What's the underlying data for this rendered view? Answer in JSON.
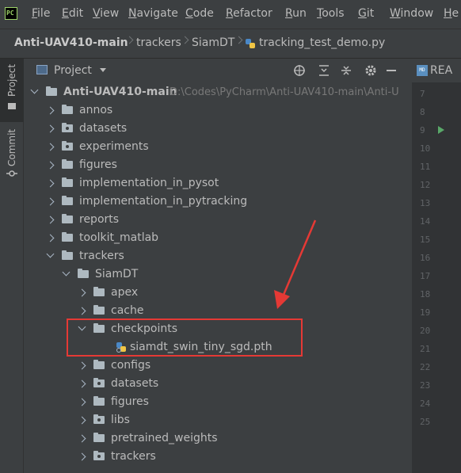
{
  "menu": {
    "logo_text": "PC",
    "items": [
      {
        "mn": "F",
        "rest": "ile"
      },
      {
        "mn": "E",
        "rest": "dit"
      },
      {
        "mn": "V",
        "rest": "iew"
      },
      {
        "mn": "N",
        "rest": "avigate"
      },
      {
        "mn": "C",
        "rest": "ode"
      },
      {
        "mn": "R",
        "rest": "efactor"
      },
      {
        "mn": "R",
        "rest": "un",
        "pre": ""
      },
      {
        "mn": "T",
        "rest": "ools"
      },
      {
        "mn": "G",
        "rest": "it"
      },
      {
        "mn": "W",
        "rest": "indow"
      },
      {
        "mn": "H",
        "rest": "e"
      }
    ]
  },
  "breadcrumb": {
    "project": "Anti-UAV410-main",
    "items": [
      "trackers",
      "SiamDT"
    ],
    "file": "tracking_test_demo.py"
  },
  "toolstrip": {
    "project_tab": "Project",
    "commit_tab": "Commit"
  },
  "panel": {
    "title": "Project"
  },
  "tree": {
    "root_name": "Anti-UAV410-main",
    "root_path": "D:\\Codes\\PyCharm\\Anti-UAV410-main\\Anti-U",
    "items": [
      {
        "label": "annos"
      },
      {
        "label": "datasets"
      },
      {
        "label": "experiments"
      },
      {
        "label": "figures"
      },
      {
        "label": "implementation_in_pysot"
      },
      {
        "label": "implementation_in_pytracking"
      },
      {
        "label": "reports"
      },
      {
        "label": "toolkit_matlab"
      },
      {
        "label": "trackers"
      },
      {
        "label": "SiamDT"
      },
      {
        "label": "apex"
      },
      {
        "label": "cache"
      },
      {
        "label": "checkpoints"
      },
      {
        "label": "siamdt_swin_tiny_sgd.pth"
      },
      {
        "label": "configs"
      },
      {
        "label": "datasets"
      },
      {
        "label": "figures"
      },
      {
        "label": "libs"
      },
      {
        "label": "pretrained_weights"
      },
      {
        "label": "trackers"
      }
    ]
  },
  "editor": {
    "tab_label": "REA",
    "line_numbers": [
      "7",
      "8",
      "9",
      "10",
      "11",
      "12",
      "13",
      "14",
      "15",
      "16",
      "17",
      "18",
      "19",
      "20",
      "21",
      "22",
      "23",
      "24",
      "25"
    ]
  },
  "colors": {
    "accent_highlight": "#e53935",
    "run_marker": "#59a869"
  }
}
